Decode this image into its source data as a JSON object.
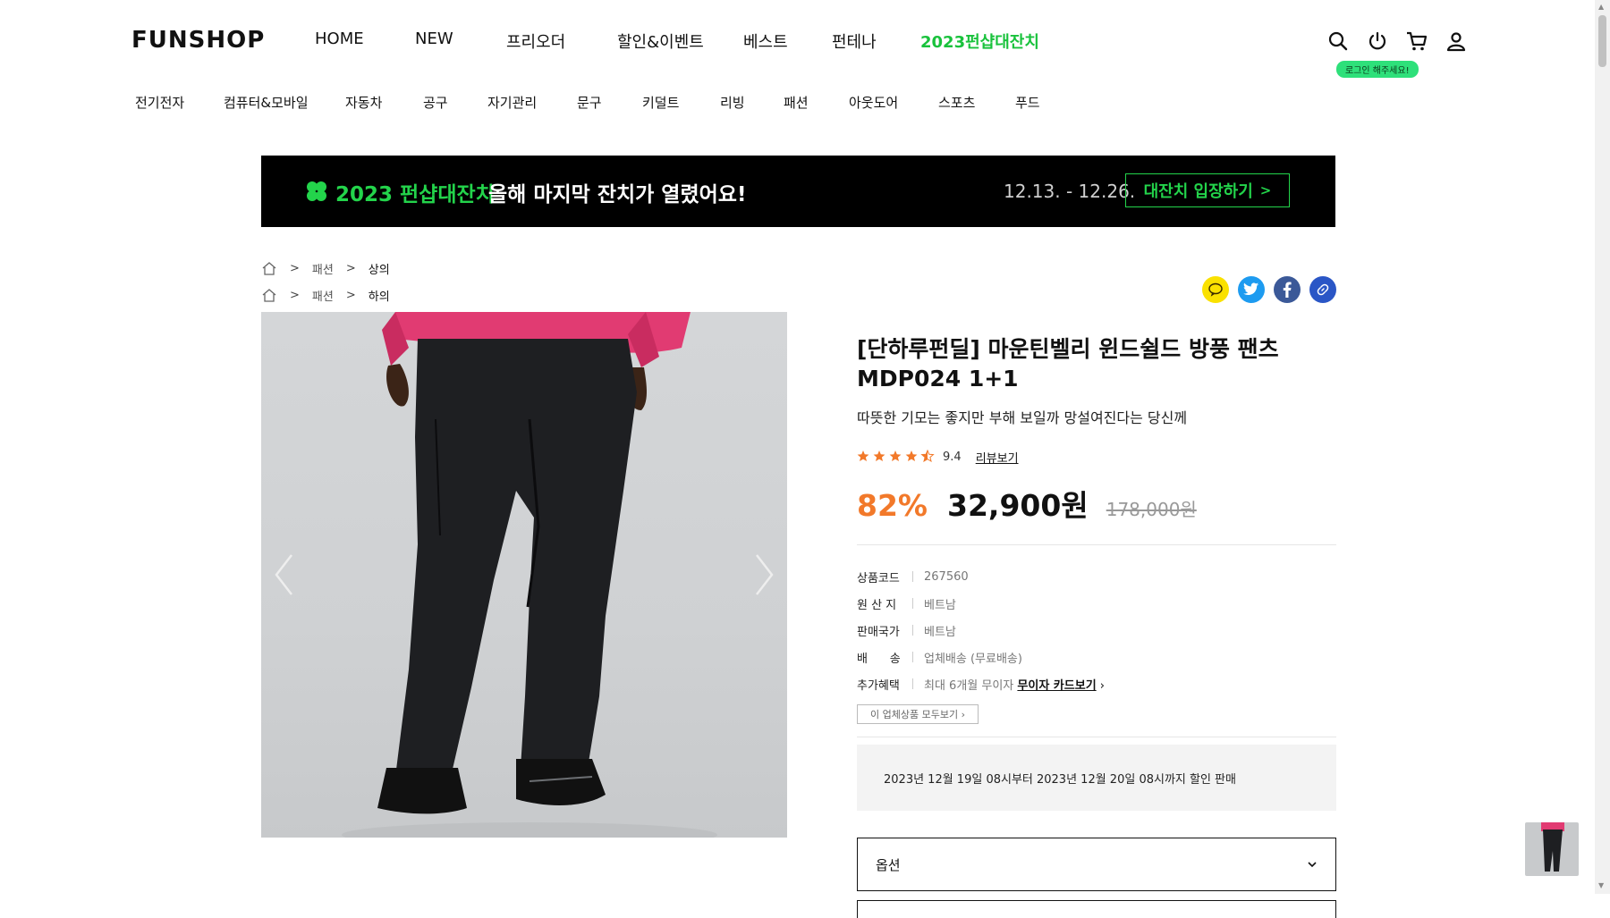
{
  "header": {
    "logo": "FUNSHOP",
    "gnb": [
      "HOME",
      "NEW",
      "프리오더",
      "할인&이벤트",
      "베스트",
      "펀테나",
      "2023펀샵대잔치"
    ],
    "login_badge": "로그인 해주세요!"
  },
  "categories": [
    "전기전자",
    "컴퓨터&모바일",
    "자동차",
    "공구",
    "자기관리",
    "문구",
    "키덜트",
    "리빙",
    "패션",
    "아웃도어",
    "스포츠",
    "푸드"
  ],
  "banner": {
    "title_green": "2023 펀샵대잔치",
    "title_white": "올해 마지막 잔치가 열렸어요!",
    "date": "12.13. - 12.26.",
    "button": "대잔치 입장하기",
    "button_arrow": ">"
  },
  "breadcrumbs": [
    {
      "level1": "패션",
      "level2": "상의"
    },
    {
      "level1": "패션",
      "level2": "하의"
    }
  ],
  "breadcrumb_sep": ">",
  "product": {
    "name": "[단하루펀딜] 마운틴벨리 윈드쉴드 방풍 팬츠 MDP024 1+1",
    "subtitle": "따뜻한 기모는 좋지만 부해 보일까 망설여진다는 당신께",
    "rating": "9.4",
    "rating_stars": 4.5,
    "review_link": "리뷰보기",
    "discount_rate": "82%",
    "price": "32,900원",
    "original_price": "178,000원",
    "specs": [
      {
        "key": "상품코드",
        "value": "267560"
      },
      {
        "key": "원 산 지",
        "value": "베트남"
      },
      {
        "key": "판매국가",
        "value": "베트남"
      },
      {
        "key": "배      송",
        "value": "업체배송 (무료배송)"
      },
      {
        "key": "추가혜택",
        "value": "최대 6개월 무이자",
        "link": "무이자 카드보기"
      }
    ],
    "seller_all": "이 업체상품 모두보기",
    "notice": "2023년 12월 19일 08시부터 2023년 12월 20일 08시까지 할인 판매",
    "option_label": "옵션"
  },
  "colors": {
    "accent_green": "#23d44b",
    "discount_orange": "#f2792a",
    "login_badge": "#2ee07a"
  }
}
